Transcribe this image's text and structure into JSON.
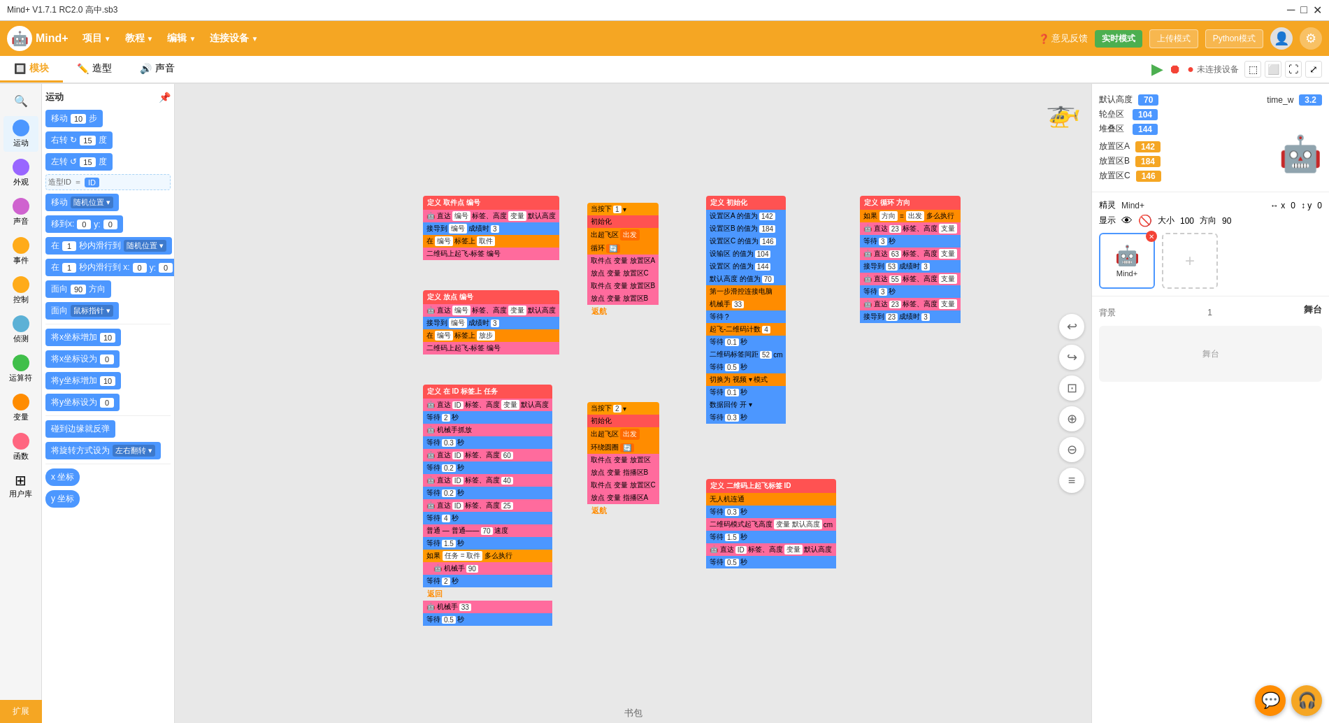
{
  "titlebar": {
    "title": "Mind+ V1.7.1 RC2.0  高中.sb3",
    "controls": [
      "minimize",
      "maximize",
      "close"
    ]
  },
  "menubar": {
    "logo": "Mind+",
    "items": [
      {
        "label": "项目",
        "has_arrow": true
      },
      {
        "label": "教程",
        "has_arrow": true
      },
      {
        "label": "编辑",
        "has_arrow": true
      },
      {
        "label": "连接设备",
        "has_arrow": true
      }
    ],
    "right": {
      "feedback": "意见反馈",
      "realtime": "实时模式",
      "upload": "上传模式",
      "python": "Python模式"
    }
  },
  "tabs": {
    "items": [
      {
        "label": "模块",
        "icon": "🔲",
        "active": true
      },
      {
        "label": "造型",
        "icon": "✏️"
      },
      {
        "label": "声音",
        "icon": "🔊"
      }
    ]
  },
  "sidebar": {
    "categories": [
      {
        "id": "search",
        "label": "",
        "icon": "🔍",
        "color": ""
      },
      {
        "id": "motion",
        "label": "运动",
        "color": "#4C97FF"
      },
      {
        "id": "looks",
        "label": "外观",
        "color": "#9966FF"
      },
      {
        "id": "sound",
        "label": "声音",
        "color": "#CF63CF"
      },
      {
        "id": "events",
        "label": "事件",
        "color": "#FFAB19"
      },
      {
        "id": "control",
        "label": "控制",
        "color": "#FFAB19"
      },
      {
        "id": "sensing",
        "label": "侦测",
        "color": "#5CB1D6"
      },
      {
        "id": "operators",
        "label": "运算符",
        "color": "#40BF4A"
      },
      {
        "id": "variables",
        "label": "变量",
        "color": "#FF8C00"
      },
      {
        "id": "functions",
        "label": "函数",
        "color": "#FF6680"
      },
      {
        "id": "userlib",
        "label": "用户库",
        "icon": "⊞",
        "color": "#888"
      }
    ],
    "active": "motion",
    "section_title": "运动",
    "blocks": [
      {
        "label": "移动",
        "val": "10",
        "suffix": "步",
        "color": "blue"
      },
      {
        "label": "右转 ↻",
        "val": "15",
        "suffix": "度",
        "color": "blue"
      },
      {
        "label": "左转 ↺",
        "val": "15",
        "suffix": "度",
        "color": "blue"
      },
      {
        "label": "移动 随机位置 ▼",
        "color": "blue"
      },
      {
        "label": "移到x:",
        "val": "0",
        "label2": "y:",
        "val2": "0",
        "color": "blue"
      },
      {
        "label": "在",
        "val": "1",
        "suffix": "秒内滑行到 随机位置 ▼",
        "color": "blue"
      },
      {
        "label": "在",
        "val": "1",
        "suffix2": "秒内滑行到 x:",
        "val2": "0",
        "label3": "y:",
        "val3": "0",
        "color": "blue"
      },
      {
        "label": "面向",
        "val": "90",
        "suffix": "方向",
        "color": "blue"
      },
      {
        "label": "面向 鼠标指针 ▼",
        "color": "blue"
      },
      {
        "label": "将x坐标增加",
        "val": "10",
        "color": "blue"
      },
      {
        "label": "将x坐标设为",
        "val": "0",
        "color": "blue"
      },
      {
        "label": "将y坐标增加",
        "val": "10",
        "color": "blue"
      },
      {
        "label": "将y坐标设为",
        "val": "0",
        "color": "blue"
      },
      {
        "label": "碰到边缘就反弹",
        "color": "blue"
      },
      {
        "label": "将旋转方式设为 左右翻转 ▼",
        "color": "blue"
      },
      {
        "label": "x 坐标",
        "color": "blue",
        "oval": true
      },
      {
        "label": "y 坐标",
        "color": "blue",
        "oval": true
      }
    ]
  },
  "canvas": {
    "label": "书包"
  },
  "right_panel": {
    "stats": {
      "default_height_label": "默认高度",
      "default_height_val": "70",
      "wheel_zone_label": "轮垒区",
      "wheel_zone_val": "104",
      "stack_zone_label": "堆叠区",
      "stack_zone_val": "144"
    },
    "time_w_label": "time_w",
    "time_w_val": "3.2",
    "placement": {
      "a_label": "放置区A",
      "a_val": "142",
      "b_label": "放置区B",
      "b_val": "184",
      "c_label": "放置区C",
      "c_val": "146"
    },
    "sprite": {
      "name": "Mind+",
      "name_label": "精灵",
      "x_label": "x",
      "x_val": "0",
      "y_label": "y",
      "y_val": "0",
      "show_label": "显示",
      "size_label": "大小",
      "size_val": "100",
      "direction_label": "方向",
      "direction_val": "90"
    },
    "stage_label": "舞台",
    "background_label": "背景",
    "background_val": "1",
    "conn_status": "未连接设备"
  },
  "expand_btn": "扩展",
  "canvas_toolbar": {
    "undo_label": "↩",
    "redo_label": "↪",
    "zoom_fit": "⊡",
    "zoom_in": "⊕",
    "zoom_out": "⊖",
    "center": "≡"
  }
}
